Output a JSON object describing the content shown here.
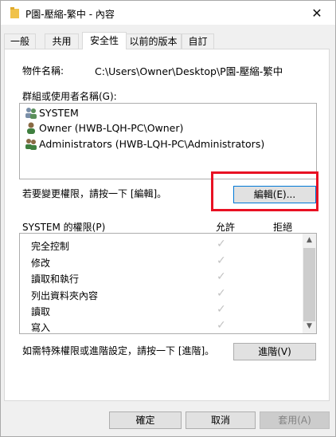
{
  "window": {
    "title": "P園-壓縮-繁中 - 內容",
    "close_glyph": "✕"
  },
  "tabs": [
    {
      "label": "一般",
      "active": false
    },
    {
      "label": "共用",
      "active": false
    },
    {
      "label": "安全性",
      "active": true
    },
    {
      "label": "以前的版本",
      "active": false
    },
    {
      "label": "自訂",
      "active": false
    }
  ],
  "security": {
    "object_name_label": "物件名稱:",
    "object_name_value": "C:\\Users\\Owner\\Desktop\\P園-壓縮-繁中",
    "groups_label": "群組或使用者名稱(G):",
    "users": [
      {
        "name": "SYSTEM",
        "icon": "user-group-icon"
      },
      {
        "name": "Owner (HWB-LQH-PC\\Owner)",
        "icon": "user-icon"
      },
      {
        "name": "Administrators (HWB-LQH-PC\\Administrators)",
        "icon": "user-group-icon"
      }
    ],
    "change_hint": "若要變更權限，請按一下 [編輯]。",
    "edit_button": "編輯(E)...",
    "permissions_label": "SYSTEM 的權限(P)",
    "allow_header": "允許",
    "deny_header": "拒絕",
    "permissions": [
      {
        "name": "完全控制",
        "allow": "✓",
        "deny": ""
      },
      {
        "name": "修改",
        "allow": "✓",
        "deny": ""
      },
      {
        "name": "讀取和執行",
        "allow": "✓",
        "deny": ""
      },
      {
        "name": "列出資料夾內容",
        "allow": "✓",
        "deny": ""
      },
      {
        "name": "讀取",
        "allow": "✓",
        "deny": ""
      },
      {
        "name": "寫入",
        "allow": "✓",
        "deny": ""
      }
    ],
    "advanced_hint": "如需特殊權限或進階設定，請按一下 [進階]。",
    "advanced_button": "進階(V)"
  },
  "footer": {
    "ok": "確定",
    "cancel": "取消",
    "apply": "套用(A)"
  },
  "colors": {
    "accent": "#0078d7",
    "highlight": "#e81123"
  }
}
